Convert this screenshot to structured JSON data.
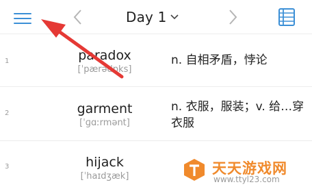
{
  "header": {
    "day_label": "Day 1",
    "menu_icon": "menu-icon",
    "prev_icon": "chevron-left-icon",
    "next_icon": "chevron-right-icon",
    "dropdown_icon": "chevron-down-icon",
    "list_icon": "word-list-icon",
    "accent_color": "#3b8fd6"
  },
  "words": [
    {
      "index": "1",
      "word": "paradox",
      "phonetic": "[ˈpærədɒks]",
      "meaning": "n. 自相矛盾，悖论"
    },
    {
      "index": "2",
      "word": "garment",
      "phonetic": "[ˈɡɑːrmənt]",
      "meaning": "n. 衣服，服装；v. 给…穿衣服"
    },
    {
      "index": "3",
      "word": "hijack",
      "phonetic": "[ˈhaɪdʒæk]",
      "meaning": ""
    }
  ],
  "annotation": {
    "color": "#e53935",
    "icon": "red-arrow-annotation"
  },
  "watermark": {
    "title": "天天游戏网",
    "url": "www.ttyl23.com",
    "color": "#f08a2c"
  }
}
